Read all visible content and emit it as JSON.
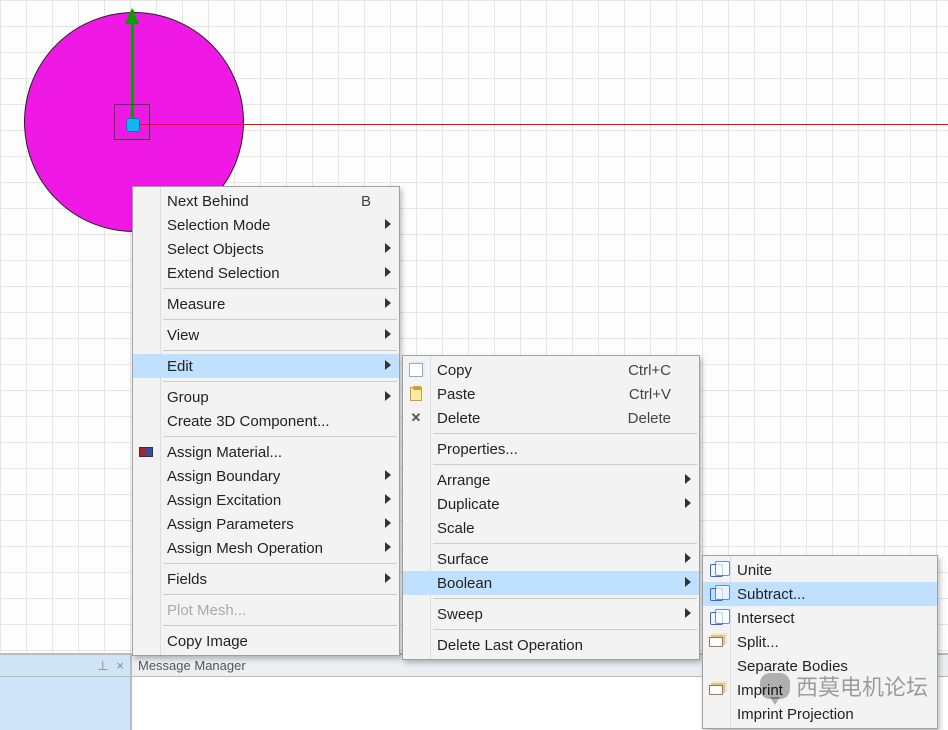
{
  "panel": {
    "title": "Message Manager",
    "pin_glyph": "⊥",
    "close_glyph": "×"
  },
  "watermark": "西莫电机论坛",
  "menu1": {
    "next_behind": "Next Behind",
    "next_behind_key": "B",
    "selection_mode": "Selection Mode",
    "select_objects": "Select Objects",
    "extend_selection": "Extend Selection",
    "measure": "Measure",
    "view": "View",
    "edit": "Edit",
    "group": "Group",
    "create_3d": "Create 3D Component...",
    "assign_material": "Assign Material...",
    "assign_boundary": "Assign Boundary",
    "assign_excitation": "Assign Excitation",
    "assign_parameters": "Assign Parameters",
    "assign_mesh": "Assign Mesh Operation",
    "fields": "Fields",
    "plot_mesh": "Plot Mesh...",
    "copy_image": "Copy Image"
  },
  "menu2": {
    "copy": "Copy",
    "copy_k": "Ctrl+C",
    "paste": "Paste",
    "paste_k": "Ctrl+V",
    "delete": "Delete",
    "delete_k": "Delete",
    "properties": "Properties...",
    "arrange": "Arrange",
    "duplicate": "Duplicate",
    "scale": "Scale",
    "surface": "Surface",
    "boolean": "Boolean",
    "sweep": "Sweep",
    "delete_last": "Delete Last Operation"
  },
  "menu3": {
    "unite": "Unite",
    "subtract": "Subtract...",
    "intersect": "Intersect",
    "split": "Split...",
    "separate": "Separate Bodies",
    "imprint": "Imprint",
    "imprint_proj": "Imprint Projection"
  }
}
